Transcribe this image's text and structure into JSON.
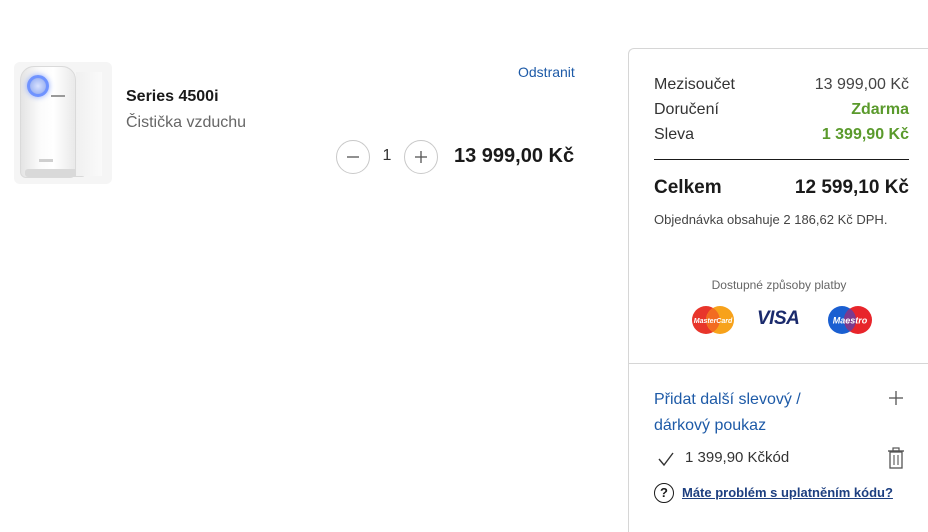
{
  "cart": {
    "item": {
      "name": "Series 4500i",
      "subtitle": "Čistička vzduchu",
      "remove_label": "Odstranit",
      "quantity": "1",
      "price": "13 999,00 Kč",
      "image_icon": "air-purifier-image"
    }
  },
  "summary": {
    "subtotal_label": "Mezisoučet",
    "subtotal_value": "13 999,00 Kč",
    "delivery_label": "Doručení",
    "delivery_value": "Zdarma",
    "discount_label": "Sleva",
    "discount_value": "1 399,90 Kč",
    "total_label": "Celkem",
    "total_value": "12 599,10 Kč",
    "vat_note": "Objednávka obsahuje 2 186,62 Kč DPH.",
    "payment_title": "Dostupné způsoby platby",
    "payment_methods": [
      "MasterCard",
      "VISA",
      "Maestro"
    ],
    "voucher_link": "Přidat další slevový / dárkový poukaz",
    "applied_voucher": "1 399,90 Kčkód",
    "help_link": "Máte problém s uplatněním kódu?",
    "help_icon_glyph": "?",
    "accent_color": "#1d5aa7",
    "green_color": "#5a9a2c"
  }
}
